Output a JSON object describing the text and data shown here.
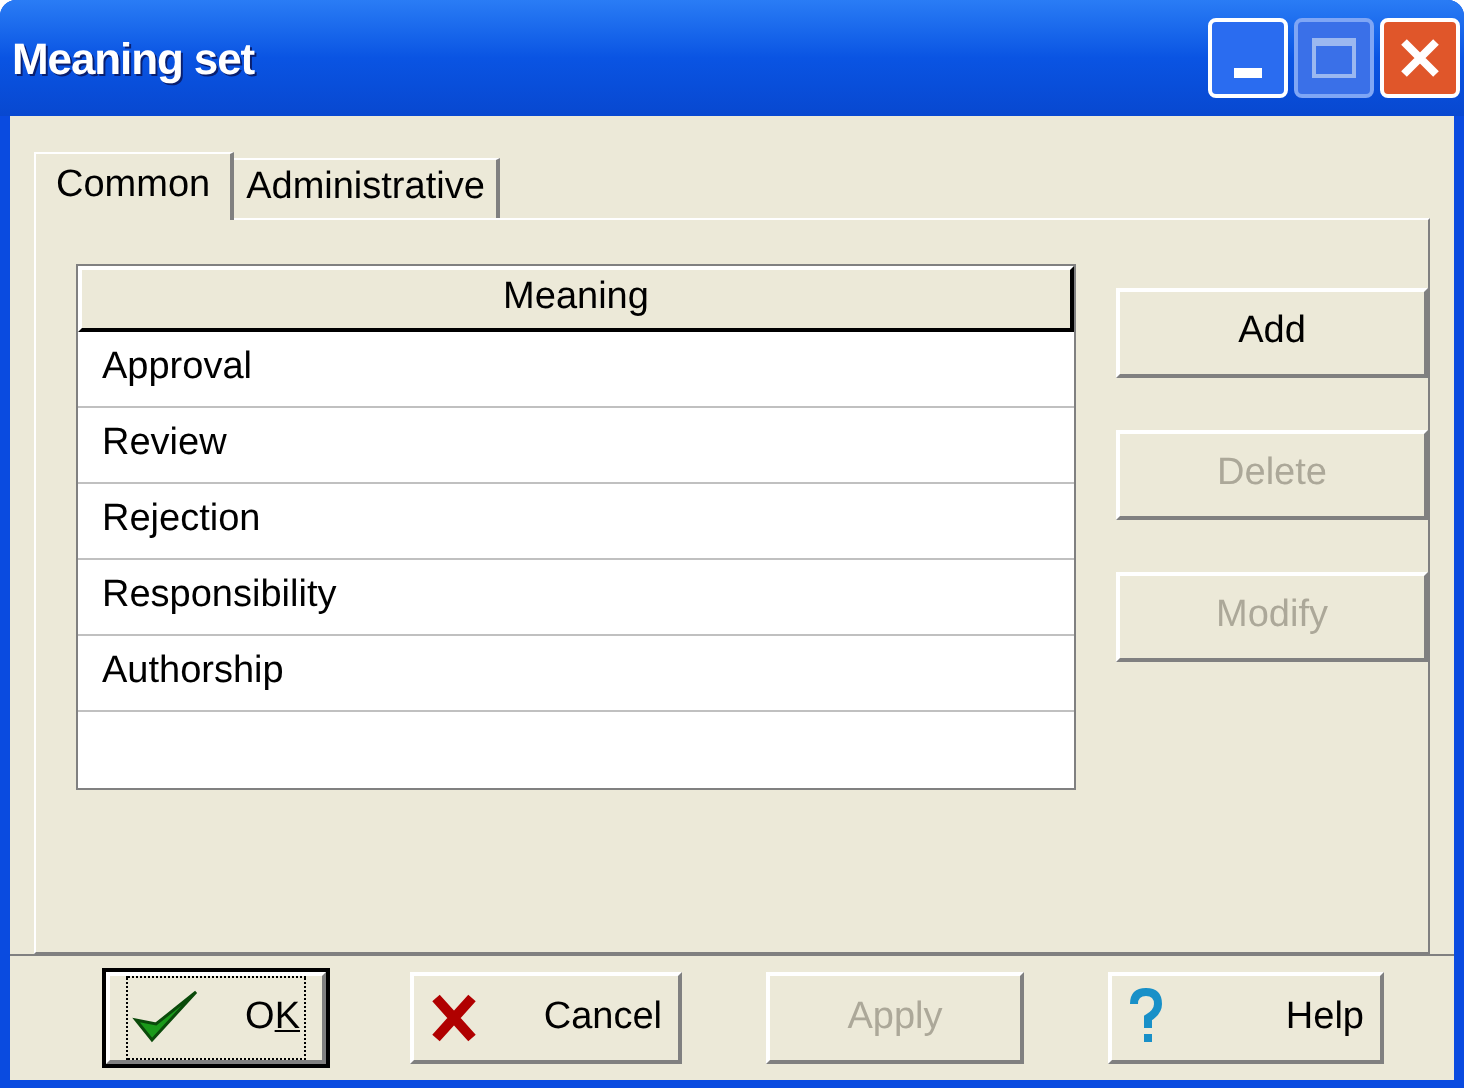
{
  "window": {
    "title": "Meaning set"
  },
  "tabs": [
    {
      "label": "Common",
      "selected": true
    },
    {
      "label": "Administrative",
      "selected": false
    }
  ],
  "table": {
    "columns": [
      "Meaning"
    ],
    "rows": [
      "Approval",
      "Review",
      "Rejection",
      "Responsibility",
      "Authorship"
    ]
  },
  "side_buttons": [
    {
      "label": "Add",
      "disabled": false
    },
    {
      "label": "Delete",
      "disabled": true
    },
    {
      "label": "Modify",
      "disabled": true
    }
  ],
  "dialog_buttons": [
    {
      "label_parts": [
        {
          "text": "O",
          "underlined": false
        },
        {
          "text": "K",
          "underlined": true
        }
      ],
      "kind": "ok",
      "disabled": false,
      "default": true
    },
    {
      "label": "Cancel",
      "kind": "cancel",
      "disabled": false,
      "default": false
    },
    {
      "label": "Apply",
      "kind": "none",
      "disabled": true,
      "default": false
    },
    {
      "label": "Help",
      "kind": "help",
      "disabled": false,
      "default": false
    }
  ]
}
